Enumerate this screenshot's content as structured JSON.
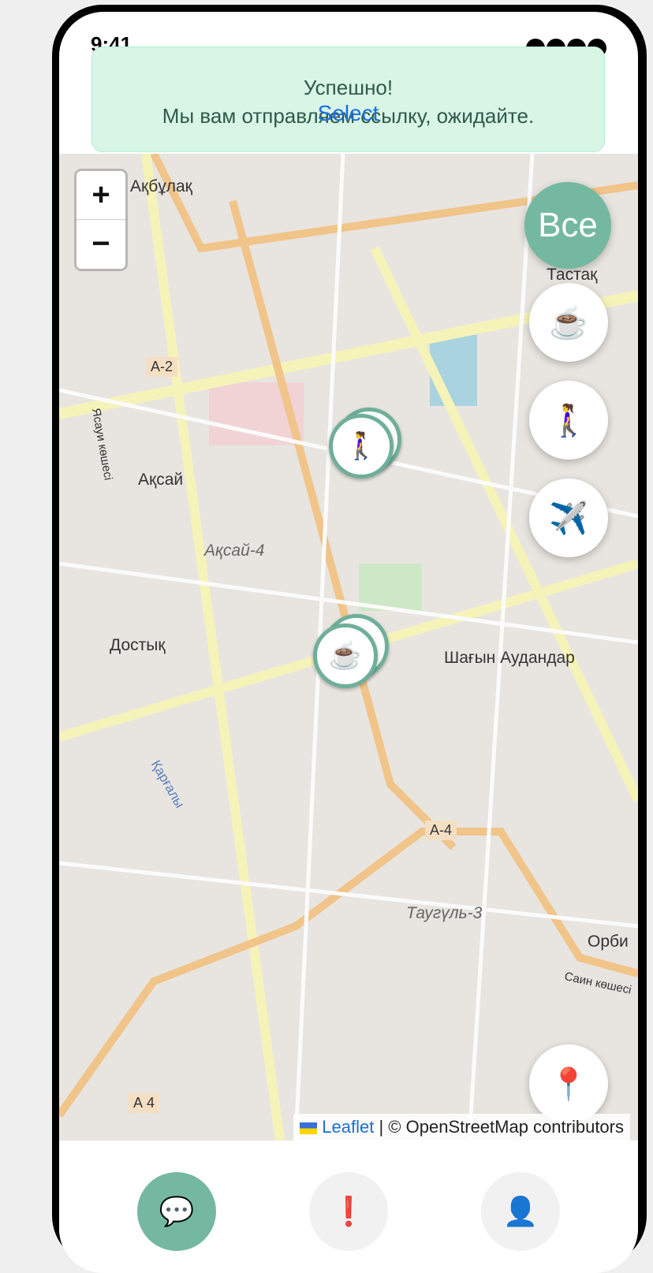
{
  "status_bar": {
    "time": "9:41"
  },
  "alert": {
    "title": "Успешно!",
    "message": "Мы вам отправляем ссылку, ожидайте.",
    "overlay_label": "Select"
  },
  "map": {
    "zoom_in": "+",
    "zoom_out": "−",
    "filters": {
      "all_label": "Все",
      "coffee_icon": "☕",
      "walk_icon": "🚶‍♀️",
      "plane_icon": "✈️"
    },
    "markers": [
      {
        "icon": "🚶‍♀️",
        "category": "walk"
      },
      {
        "icon": "☕",
        "category": "coffee"
      }
    ],
    "labels": [
      "Ақбұлақ",
      "Тастақ",
      "Ақсай",
      "Ақсай-4",
      "Достық",
      "Шағын Аудандар",
      "Таугүль-3",
      "Орби",
      "А-2",
      "А-4",
      "А 4",
      "Саин көшесі",
      "Ясауи көшесі",
      "Қарғалы"
    ],
    "location_icon": "📍",
    "attribution": {
      "link": "Leaflet",
      "text": "| © OpenStreetMap contributors"
    }
  },
  "tabbar": {
    "chat_icon": "💬",
    "alert_icon": "❗",
    "profile_icon": "👤"
  },
  "colors": {
    "accent": "#74b8a1",
    "alert_bg": "#d8f5e6",
    "alert_text": "#2f5a48"
  }
}
